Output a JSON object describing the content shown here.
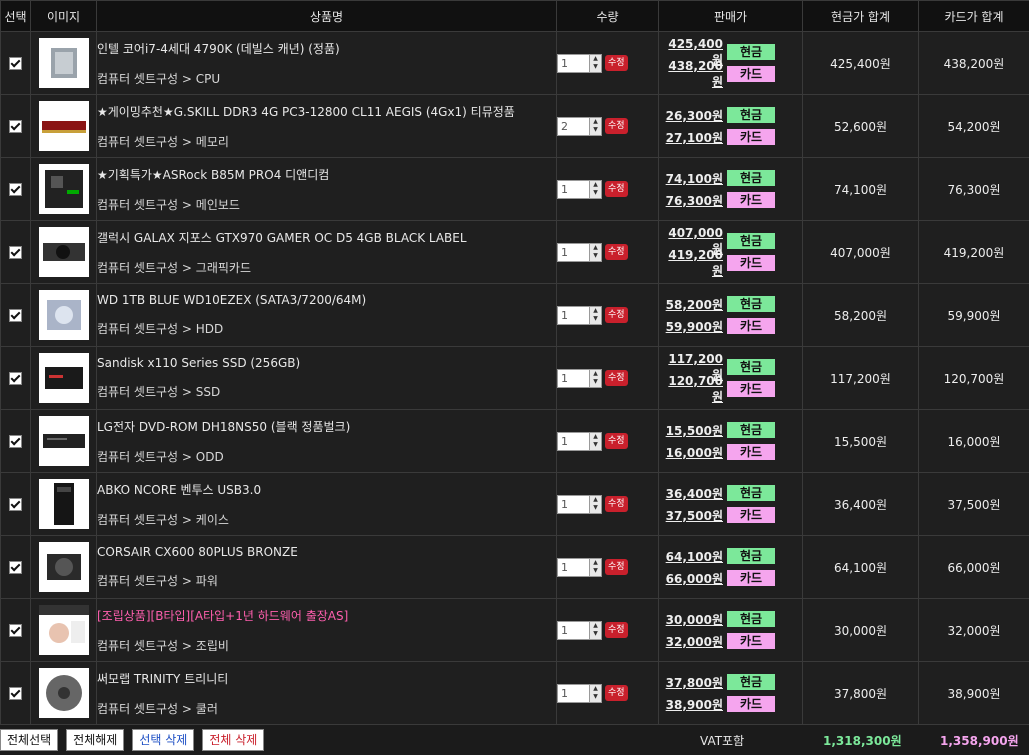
{
  "headers": [
    "선택",
    "이미지",
    "상품명",
    "수량",
    "판매가",
    "현금가 합계",
    "카드가 합계"
  ],
  "badges": {
    "cash": "현금",
    "card": "카드"
  },
  "modify_label": "수정",
  "rows": [
    {
      "name": "인텔 코어i7-4세대 4790K (데빌스 캐년) (정품)",
      "cat": "컴퓨터 셋트구성 > CPU",
      "qty": "1",
      "cash": "425,400원",
      "card": "438,200원",
      "cash_total": "425,400원",
      "card_total": "438,200원",
      "img": "cpu-image"
    },
    {
      "name": "★게이밍추천★G.SKILL DDR3 4G PC3-12800 CL11 AEGIS (4Gx1) 티뮤정품",
      "cat": "컴퓨터 셋트구성 > 메모리",
      "qty": "2",
      "cash": "26,300원",
      "card": "27,100원",
      "cash_total": "52,600원",
      "card_total": "54,200원",
      "img": "ram-image"
    },
    {
      "name": "★기획특가★ASRock B85M PRO4 디앤디컴",
      "cat": "컴퓨터 셋트구성 > 메인보드",
      "qty": "1",
      "cash": "74,100원",
      "card": "76,300원",
      "cash_total": "74,100원",
      "card_total": "76,300원",
      "img": "mainboard-image"
    },
    {
      "name": "갤럭시 GALAX 지포스 GTX970 GAMER OC D5 4GB BLACK LABEL",
      "cat": "컴퓨터 셋트구성 > 그래픽카드",
      "qty": "1",
      "cash": "407,000원",
      "card": "419,200원",
      "cash_total": "407,000원",
      "card_total": "419,200원",
      "img": "gpu-image"
    },
    {
      "name": "WD 1TB BLUE WD10EZEX (SATA3/7200/64M)",
      "cat": "컴퓨터 셋트구성 > HDD",
      "qty": "1",
      "cash": "58,200원",
      "card": "59,900원",
      "cash_total": "58,200원",
      "card_total": "59,900원",
      "img": "hdd-image"
    },
    {
      "name": "Sandisk x110 Series SSD (256GB)",
      "cat": "컴퓨터 셋트구성 > SSD",
      "qty": "1",
      "cash": "117,200원",
      "card": "120,700원",
      "cash_total": "117,200원",
      "card_total": "120,700원",
      "img": "ssd-image"
    },
    {
      "name": "LG전자 DVD-ROM DH18NS50 (블랙 정품벌크)",
      "cat": "컴퓨터 셋트구성 > ODD",
      "qty": "1",
      "cash": "15,500원",
      "card": "16,000원",
      "cash_total": "15,500원",
      "card_total": "16,000원",
      "img": "odd-image"
    },
    {
      "name": "ABKO NCORE 벤투스 USB3.0",
      "cat": "컴퓨터 셋트구성 > 케이스",
      "qty": "1",
      "cash": "36,400원",
      "card": "37,500원",
      "cash_total": "36,400원",
      "card_total": "37,500원",
      "img": "case-image"
    },
    {
      "name": "CORSAIR CX600 80PLUS BRONZE",
      "cat": "컴퓨터 셋트구성 > 파워",
      "qty": "1",
      "cash": "64,100원",
      "card": "66,000원",
      "cash_total": "64,100원",
      "card_total": "66,000원",
      "img": "psu-image"
    },
    {
      "name": "[조립상품][B타입][A타입+1년 하드웨어 출장AS]",
      "cat": "컴퓨터 셋트구성 > 조립비",
      "qty": "1",
      "cash": "30,000원",
      "card": "32,000원",
      "cash_total": "30,000원",
      "card_total": "32,000원",
      "img": "assembly-image",
      "highlight": true
    },
    {
      "name": "써모랩 TRINITY 트리니티",
      "cat": "컴퓨터 셋트구성 > 쿨러",
      "qty": "1",
      "cash": "37,800원",
      "card": "38,900원",
      "cash_total": "37,800원",
      "card_total": "38,900원",
      "img": "cooler-image"
    }
  ],
  "footer": {
    "select_all": "전체선택",
    "deselect_all": "전체해제",
    "delete_selected": "선택 삭제",
    "delete_all": "전체 삭제",
    "vat_label": "VAT포함",
    "cash_sum": "1,318,300원",
    "card_sum": "1,358,900원"
  },
  "colors": {
    "cash": "#7ce89a",
    "card": "#f5a5ee",
    "modify": "#c9202c",
    "highlight": "#ff5fae"
  }
}
